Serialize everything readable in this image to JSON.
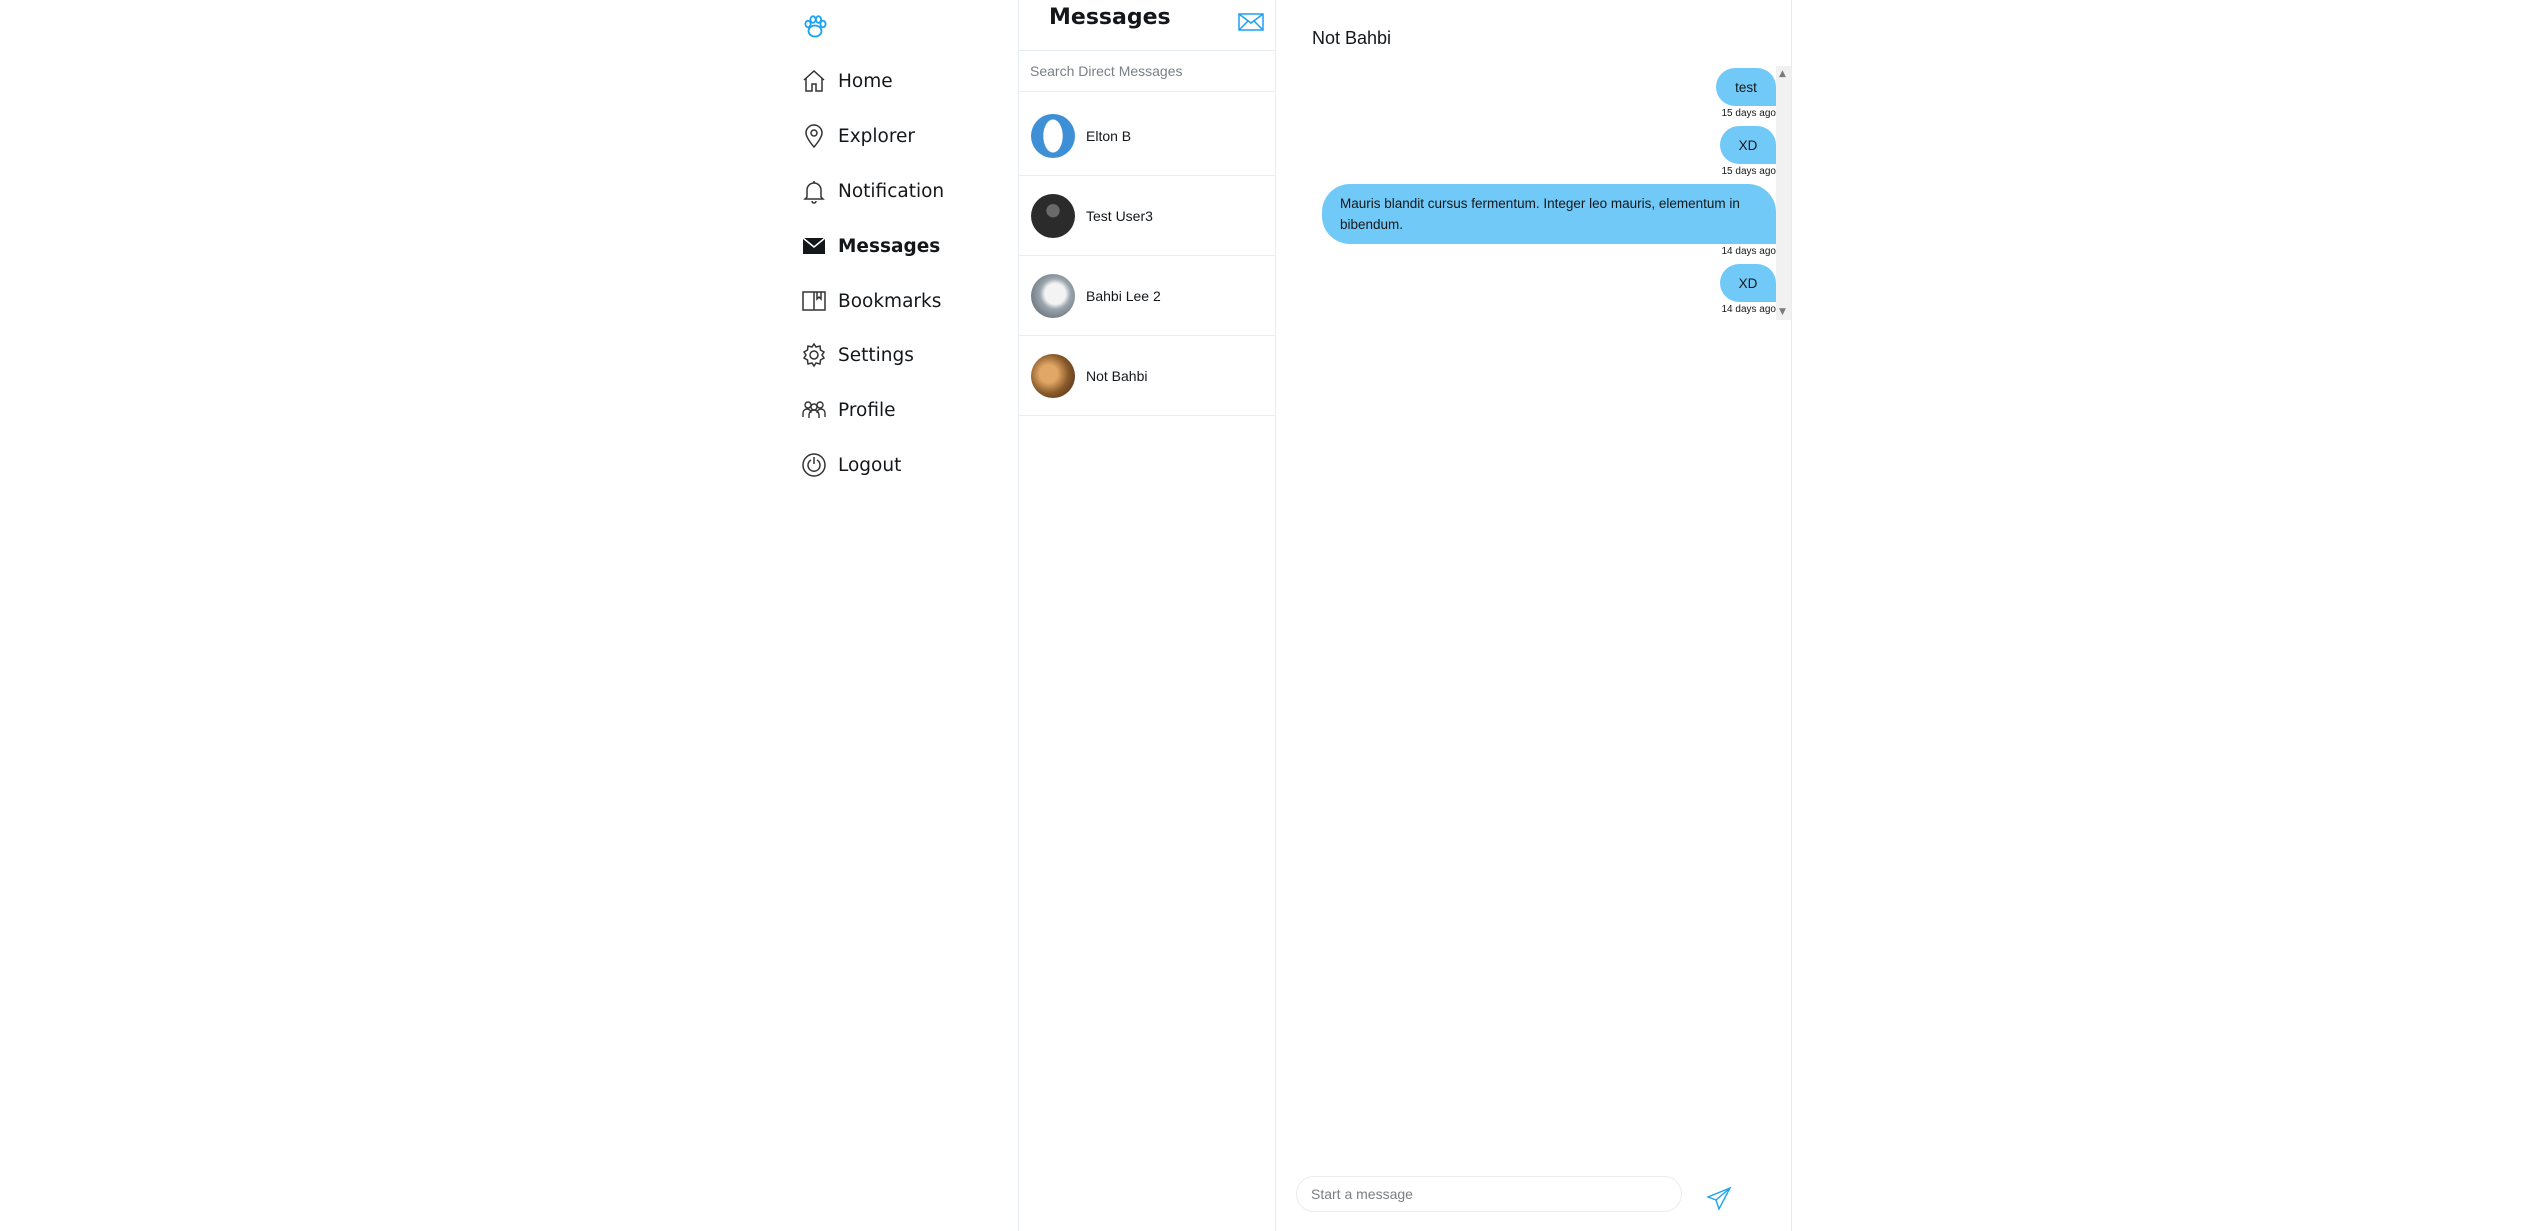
{
  "brand": {
    "logo_icon": "paw-icon",
    "accent_color": "#1da1f2"
  },
  "nav": {
    "items": [
      {
        "label": "Home",
        "icon": "home-icon"
      },
      {
        "label": "Explorer",
        "icon": "location-pin-icon"
      },
      {
        "label": "Notification",
        "icon": "bell-icon"
      },
      {
        "label": "Messages",
        "icon": "envelope-icon",
        "active": true
      },
      {
        "label": "Bookmarks",
        "icon": "book-icon"
      },
      {
        "label": "Settings",
        "icon": "gear-icon"
      },
      {
        "label": "Profile",
        "icon": "users-icon"
      },
      {
        "label": "Logout",
        "icon": "power-icon"
      }
    ]
  },
  "messages_list": {
    "title": "Messages",
    "compose_icon": "envelope-outline-icon",
    "search_placeholder": "Search Direct Messages",
    "conversations": [
      {
        "name": "Elton B"
      },
      {
        "name": "Test User3"
      },
      {
        "name": "Bahbi Lee 2"
      },
      {
        "name": "Not Bahbi"
      }
    ]
  },
  "chat": {
    "recipient": "Not Bahbi",
    "bubble_color": "#71c9f8",
    "messages": [
      {
        "text": "test",
        "time": "15 days ago"
      },
      {
        "text": "XD",
        "time": "15 days ago"
      },
      {
        "text": "Mauris blandit cursus fermentum. Integer leo mauris, elementum in bibendum.",
        "time": "14 days ago"
      },
      {
        "text": "XD",
        "time": "14 days ago"
      }
    ],
    "composer_placeholder": "Start a message",
    "send_icon": "paper-plane-icon"
  }
}
